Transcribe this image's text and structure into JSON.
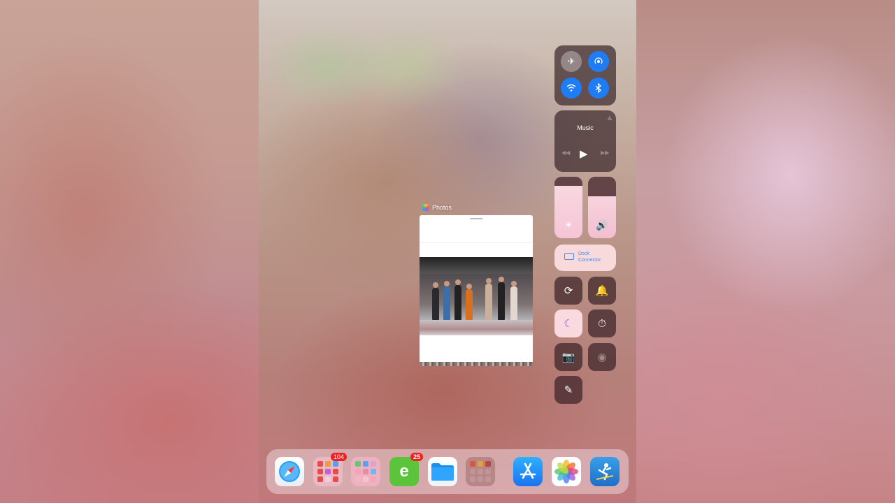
{
  "app_switcher": {
    "card": {
      "app_name": "Photos"
    }
  },
  "control_center": {
    "connectivity": {
      "airplane": "airplane-icon",
      "airdrop": "airdrop-icon",
      "wifi": "wifi-icon",
      "bluetooth": "bluetooth-icon"
    },
    "music": {
      "title": "Music"
    },
    "brightness": {
      "level": 0.85,
      "icon": "sun-icon"
    },
    "volume": {
      "level": 0.68,
      "icon": "speaker-icon"
    },
    "screen_mirroring": {
      "line1": "Dock",
      "line2": "Connector"
    },
    "toggles": [
      {
        "name": "orientation-lock",
        "glyph": "⟳"
      },
      {
        "name": "mute",
        "glyph": "🔔"
      },
      {
        "name": "do-not-disturb",
        "glyph": "☾"
      },
      {
        "name": "timer",
        "glyph": "⏱"
      },
      {
        "name": "camera",
        "glyph": "📷"
      },
      {
        "name": "screen-record",
        "glyph": "◉"
      },
      {
        "name": "notes",
        "glyph": "✎"
      }
    ]
  },
  "dock": {
    "apps": [
      {
        "name": "safari",
        "badge": ""
      },
      {
        "name": "folder-1",
        "badge": "104"
      },
      {
        "name": "folder-2",
        "badge": ""
      },
      {
        "name": "evernote-like",
        "badge": "25"
      },
      {
        "name": "files",
        "badge": ""
      },
      {
        "name": "folder-3",
        "badge": ""
      },
      {
        "name": "app-store",
        "badge": ""
      },
      {
        "name": "photos",
        "badge": ""
      },
      {
        "name": "skiing-game",
        "badge": ""
      }
    ]
  },
  "colors": {
    "blue_toggle": "#1e7cf5",
    "badge_red": "#f02020"
  }
}
